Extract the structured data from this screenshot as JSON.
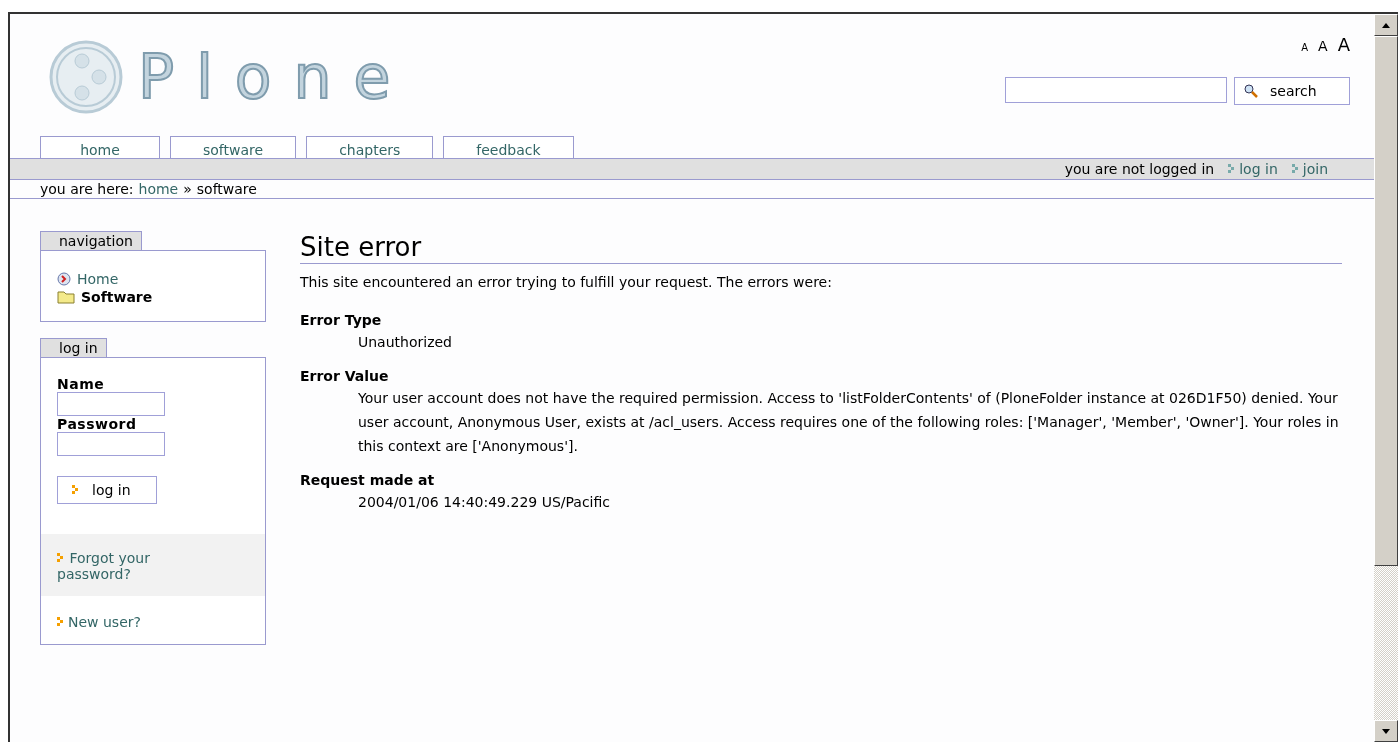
{
  "logo": {
    "text": "Plone"
  },
  "text_sizes": [
    "A",
    "A",
    "A"
  ],
  "search": {
    "button": "search"
  },
  "tabs": [
    {
      "label": "home",
      "selected": false
    },
    {
      "label": "software",
      "selected": false
    },
    {
      "label": "chapters",
      "selected": false
    },
    {
      "label": "feedback",
      "selected": false
    }
  ],
  "personal_bar": {
    "status": "you are not logged in",
    "links": [
      "log in",
      "join"
    ]
  },
  "breadcrumb": {
    "label": "you are here:",
    "items": [
      "home",
      "software"
    ],
    "separator": "»"
  },
  "navigation": {
    "title": "navigation",
    "items": [
      {
        "label": "Home",
        "kind": "link",
        "selected": false
      },
      {
        "label": "Software",
        "kind": "folder",
        "selected": true
      }
    ]
  },
  "login": {
    "title": "log in",
    "name_label": "Name",
    "password_label": "Password",
    "button": "log in",
    "forgot": "Forgot your password?",
    "new_user": "New user?"
  },
  "main": {
    "title": "Site error",
    "intro": "This site encountered an error trying to fulfill your request. The errors were:",
    "entries": [
      {
        "term": "Error Type",
        "value": "Unauthorized"
      },
      {
        "term": "Error Value",
        "value": "Your user account does not have the required permission. Access to 'listFolderContents' of (PloneFolder instance at 026D1F50) denied. Your user account, Anonymous User, exists at /acl_users. Access requires one of the following roles: ['Manager', 'Member', 'Owner']. Your roles in this context are ['Anonymous']."
      },
      {
        "term": "Request made at",
        "value": "2004/01/06 14:40:49.229 US/Pacific"
      }
    ]
  }
}
